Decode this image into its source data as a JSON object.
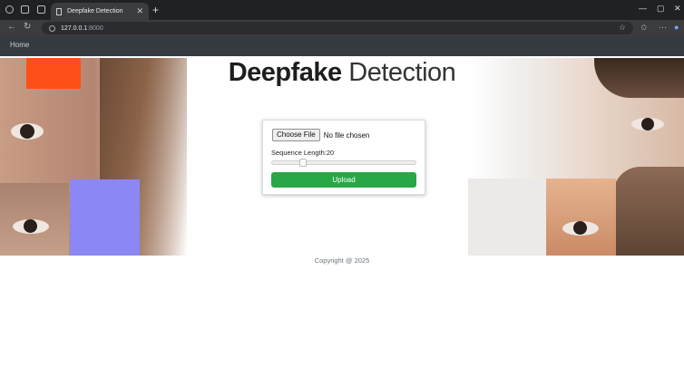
{
  "browser": {
    "tab_title": "Deepfake Detection",
    "tab_close": "✕",
    "new_tab": "+",
    "url_host": "127.0.0.1",
    "url_port": ":8000",
    "window_controls": [
      "—",
      "▢",
      "✕"
    ],
    "toolbar_icons": [
      "star-icon",
      "extensions-icon",
      "menu-icon",
      "copilot-icon"
    ]
  },
  "nav": {
    "home_label": "Home"
  },
  "hero": {
    "title_bold": "Deepfake",
    "title_light": "Detection"
  },
  "upload": {
    "choose_file_label": "Choose File",
    "no_file_text": "No file chosen",
    "sequence_label": "Sequence Length:",
    "sequence_value": "20",
    "slider_fraction": 0.2,
    "upload_label": "Upload"
  },
  "footer": {
    "copyright": "Copyright @ 2025"
  },
  "colors": {
    "nav_bg": "#343a40",
    "upload_btn": "#28a745",
    "accent_orange": "#ff4f18",
    "accent_purple": "#8b87f4"
  }
}
